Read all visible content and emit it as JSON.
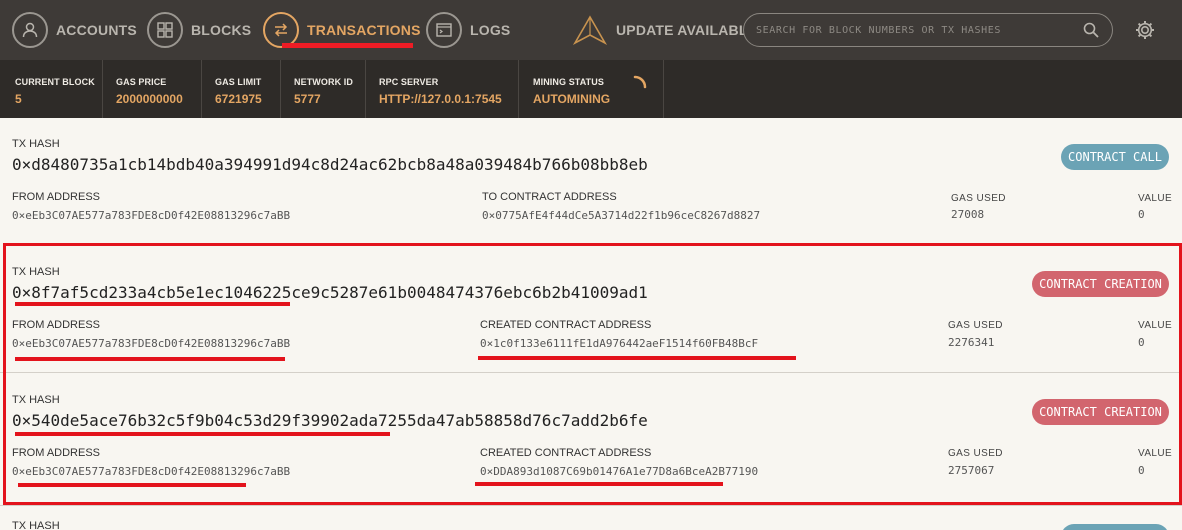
{
  "nav": {
    "accounts": "ACCOUNTS",
    "blocks": "BLOCKS",
    "transactions": "TRANSACTIONS",
    "logs": "LOGS",
    "update": "UPDATE AVAILABLE",
    "search_placeholder": "SEARCH FOR BLOCK NUMBERS OR TX HASHES"
  },
  "status": {
    "current_block_label": "CURRENT BLOCK",
    "current_block": "5",
    "gas_price_label": "GAS PRICE",
    "gas_price": "2000000000",
    "gas_limit_label": "GAS LIMIT",
    "gas_limit": "6721975",
    "network_id_label": "NETWORK ID",
    "network_id": "5777",
    "rpc_server_label": "RPC SERVER",
    "rpc_server": "HTTP://127.0.0.1:7545",
    "mining_status_label": "MINING STATUS",
    "mining_status": "AUTOMINING"
  },
  "labels": {
    "tx_hash": "TX HASH",
    "from_address": "FROM ADDRESS",
    "to_contract_address": "TO CONTRACT ADDRESS",
    "created_contract_address": "CREATED CONTRACT ADDRESS",
    "gas_used": "GAS USED",
    "value": "VALUE"
  },
  "transactions": [
    {
      "hash": "0×d8480735a1cb14bdb40a394991d94c8d24ac62bcb8a48a039484b766b08bb8eb",
      "type": "CONTRACT CALL",
      "from": "0×eEb3C07AE577a783FDE8cD0f42E08813296c7aBB",
      "to": "0×0775AfE4f44dCe5A3714d22f1b96ceC8267d8827",
      "gas_used": "27008",
      "value": "0"
    },
    {
      "hash": "0×8f7af5cd233a4cb5e1ec1046225ce9c5287e61b0048474376ebc6b2b41009ad1",
      "type": "CONTRACT CREATION",
      "from": "0×eEb3C07AE577a783FDE8cD0f42E08813296c7aBB",
      "to": "0×1c0f133e6111fE1dA976442aeF1514f60FB48BcF",
      "gas_used": "2276341",
      "value": "0"
    },
    {
      "hash": "0×540de5ace76b32c5f9b04c53d29f39902ada7255da47ab58858d76c7add2b6fe",
      "type": "CONTRACT CREATION",
      "from": "0×eEb3C07AE577a783FDE8cD0f42E08813296c7aBB",
      "to": "0×DDA893d1087C69b01476A1e77D8a6BceA2B77190",
      "gas_used": "2757067",
      "value": "0"
    }
  ],
  "colors": {
    "accent": "#e4a663",
    "call_badge": "#6ba3b5",
    "create_badge": "#d2656e",
    "annotation_red": "#e3131c"
  }
}
